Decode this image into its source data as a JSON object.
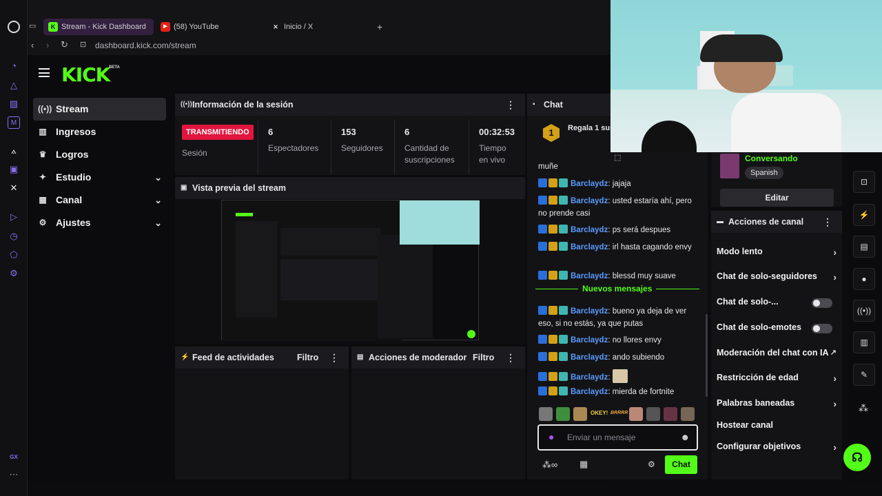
{
  "browser": {
    "tabs": [
      {
        "label": "Stream - Kick Dashboard",
        "icon": "kick-icon",
        "active": true
      },
      {
        "label": "(58) YouTube",
        "icon": "youtube-icon",
        "active": false
      },
      {
        "label": "Inicio / X",
        "icon": "x-icon",
        "active": false
      }
    ],
    "url": "dashboard.kick.com/stream"
  },
  "header": {
    "logo": "KICK",
    "beta": "BETA"
  },
  "sidebar": {
    "items": [
      {
        "label": "Stream",
        "icon": "stream-icon",
        "active": true
      },
      {
        "label": "Ingresos",
        "icon": "chart-icon"
      },
      {
        "label": "Logros",
        "icon": "trophy-icon"
      },
      {
        "label": "Estudio",
        "icon": "studio-icon",
        "expandable": true
      },
      {
        "label": "Canal",
        "icon": "channel-icon",
        "expandable": true
      },
      {
        "label": "Ajustes",
        "icon": "gear-icon",
        "expandable": true
      }
    ]
  },
  "session": {
    "title": "Información de la sesión",
    "status": "TRANSMITIENDO",
    "status_label": "Sesión",
    "stats": [
      {
        "value": "6",
        "label": "Espectadores"
      },
      {
        "value": "153",
        "label": "Seguidores"
      },
      {
        "value": "6",
        "label": "Cantidad de suscripciones"
      },
      {
        "value": "00:32:53",
        "label": "Tiempo en vivo"
      }
    ]
  },
  "preview": {
    "title": "Vista previa del stream"
  },
  "activity": {
    "title": "Feed de actividades",
    "filter": "Filtro"
  },
  "modactions": {
    "title": "Acciones de moderador",
    "filter": "Filtro"
  },
  "chat": {
    "title": "Chat",
    "pinned": {
      "rank": "1",
      "text": "Regala 1 sus"
    },
    "messages": [
      {
        "user": "",
        "text": "muñe"
      },
      {
        "user": "Barclaydz",
        "text": "jajaja"
      },
      {
        "user": "Barclaydz",
        "text": "usted estaría ahí, pero no prende casi"
      },
      {
        "user": "Barclaydz",
        "text": "ps será despues"
      },
      {
        "user": "Barclaydz",
        "text": "irl hasta cagando envy"
      },
      {
        "user": "Barclaydz",
        "text": "blessd muy suave"
      }
    ],
    "new_label": "Nuevos mensajes",
    "new_messages": [
      {
        "user": "Barclaydz",
        "text": "bueno ya deja de ver eso, si no estás, ya que putas"
      },
      {
        "user": "Barclaydz",
        "text": "no llores envy"
      },
      {
        "user": "Barclaydz",
        "text": "ando subiendo"
      },
      {
        "user": "Barclaydz",
        "text": ""
      },
      {
        "user": "Barclaydz",
        "text": "mierda de fortnite"
      }
    ],
    "emote_strip": [
      "OKEY!",
      "BRRRR"
    ],
    "input_placeholder": "Enviar un mensaje",
    "send_label": "Chat"
  },
  "stream_info": {
    "category": "Conversando",
    "language": "Spanish",
    "edit_label": "Editar"
  },
  "channel_actions": {
    "title": "Acciones de canal",
    "items": [
      {
        "label": "Modo lento",
        "control": "arrow"
      },
      {
        "label": "Chat de solo-seguidores",
        "control": "arrow"
      },
      {
        "label": "Chat de solo-...",
        "control": "toggle"
      },
      {
        "label": "Chat de solo-emotes",
        "control": "toggle"
      },
      {
        "label": "Moderación del chat con IA",
        "control": "external"
      },
      {
        "label": "Restricción de edad",
        "control": "arrow"
      },
      {
        "label": "Palabras baneadas",
        "control": "arrow"
      },
      {
        "label": "Hostear canal",
        "control": "none"
      },
      {
        "label": "Configurar objetivos",
        "control": "arrow"
      }
    ]
  },
  "colors": {
    "accent": "#53fc18",
    "live": "#e0163e",
    "username": "#5b9cff"
  }
}
